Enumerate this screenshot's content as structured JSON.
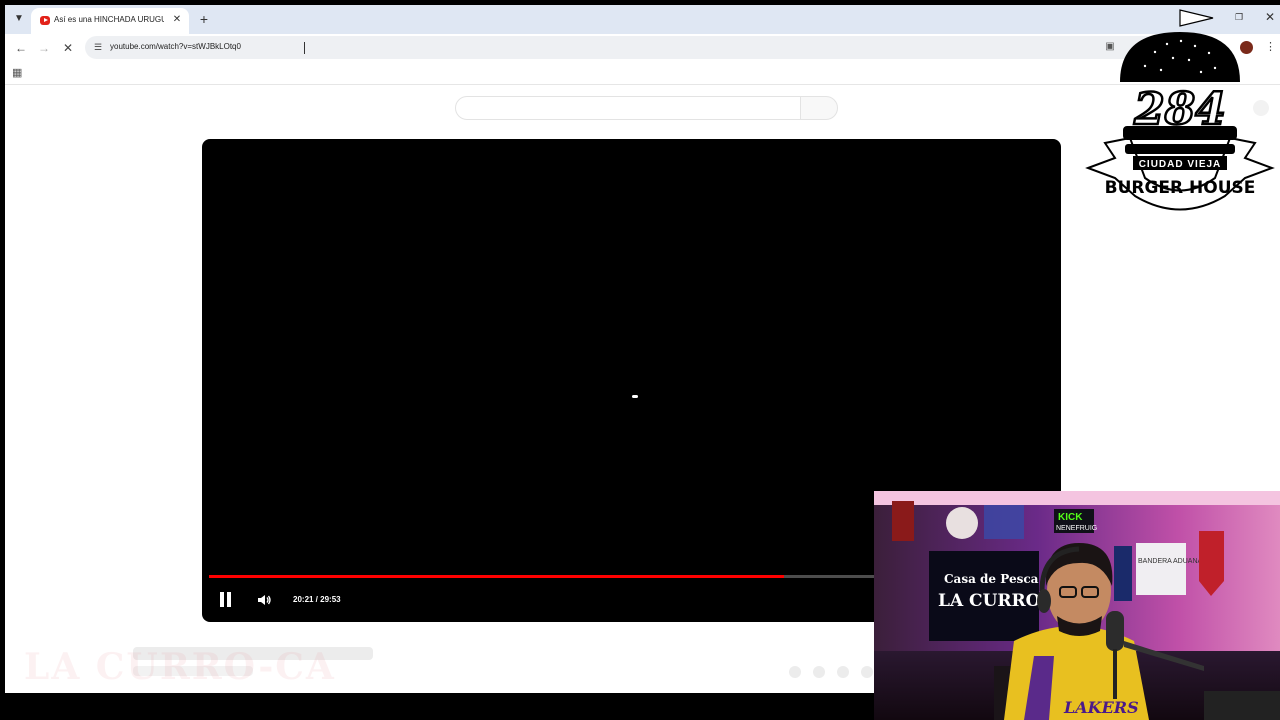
{
  "tab": {
    "title": "Así es una HINCHADA URUGUAYA"
  },
  "toolbar": {
    "url": "youtube.com/watch?v=stWJBkLOtq0"
  },
  "player": {
    "time": "20:21 / 29:53",
    "progress_fraction": 0.68
  },
  "overlay_logo": {
    "number": "284",
    "line1": "CIUDAD VIEJA",
    "line2": "BURGER HOUSE"
  },
  "watermark": "LA CURRO-CA",
  "webcam": {
    "sign_small": "Casa de Pesca",
    "sign_big": "LA CURROCA",
    "kick_text": "KICK",
    "kick_user": "NENEFRUIG",
    "flag_text": "BANDERA ADUANA",
    "jersey_text": "LAKERS"
  },
  "colors": {
    "youtube_red": "#ff0000",
    "tabstrip": "#dfe7f3"
  }
}
